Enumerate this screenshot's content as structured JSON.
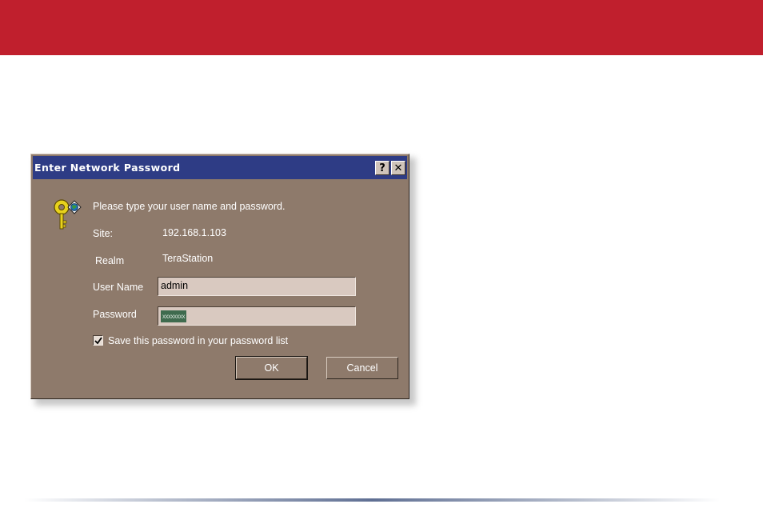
{
  "dialog": {
    "title": "Enter Network Password",
    "help_button": "?",
    "close_button": "✕",
    "prompt": "Please type your user name and password.",
    "site_label": "Site:",
    "site_value": "192.168.1.103",
    "realm_label": "Realm",
    "realm_value": "TeraStation",
    "username_label": "User Name",
    "username_value": "admin",
    "password_label": "Password",
    "password_value": "xxxxxxxx",
    "save_checkbox_label": "Save this password in your password list",
    "save_checkbox_checked": true,
    "ok_label": "OK",
    "cancel_label": "Cancel"
  },
  "icons": {
    "key": "key-icon",
    "checkmark": "checkmark-icon"
  },
  "colors": {
    "banner": "#c01f2d",
    "titlebar": "#2e3c85",
    "dialog_face": "#8e7a6b"
  }
}
